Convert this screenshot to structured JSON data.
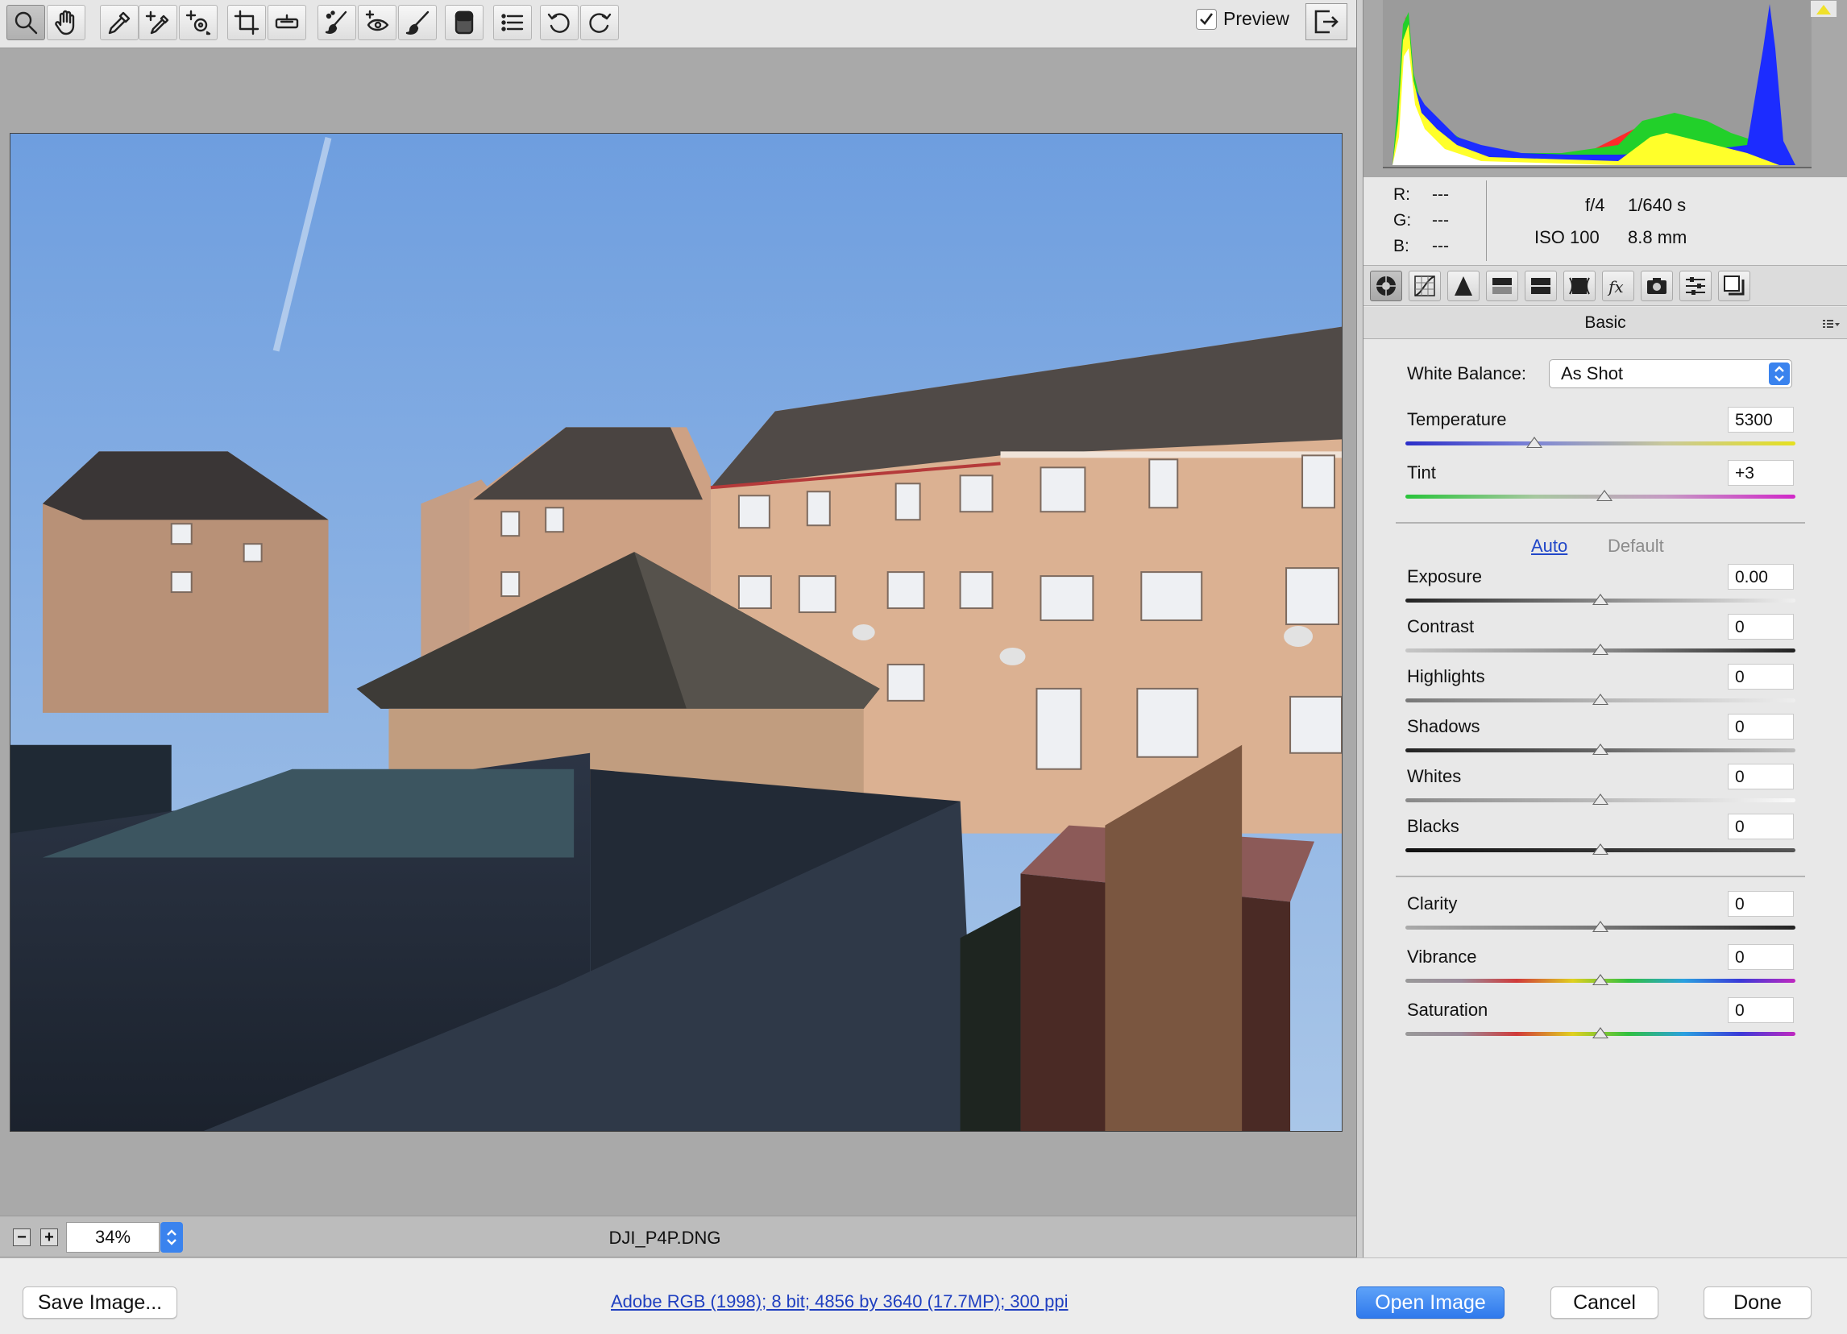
{
  "toolbar": {
    "tools": [
      {
        "name": "zoom-tool",
        "icon": "magnifier-icon",
        "active": true
      },
      {
        "name": "hand-tool",
        "icon": "hand-icon"
      },
      {
        "name": "white-balance-tool",
        "icon": "eyedropper-icon"
      },
      {
        "name": "color-sampler-tool",
        "icon": "eyedropper-plus-icon"
      },
      {
        "name": "targeted-adjustment-tool",
        "icon": "target-icon"
      },
      {
        "name": "crop-tool",
        "icon": "crop-icon"
      },
      {
        "name": "straighten-tool",
        "icon": "level-icon"
      },
      {
        "name": "spot-removal-tool",
        "icon": "brush-spots-icon"
      },
      {
        "name": "red-eye-tool",
        "icon": "eye-icon"
      },
      {
        "name": "adjustment-brush-tool",
        "icon": "brush-icon"
      },
      {
        "name": "graduated-filter-tool",
        "icon": "gradient-icon"
      },
      {
        "name": "preferences-button",
        "icon": "list-icon"
      },
      {
        "name": "rotate-left-button",
        "icon": "rotate-ccw-icon"
      },
      {
        "name": "rotate-right-button",
        "icon": "rotate-cw-icon"
      }
    ],
    "preview_label": "Preview",
    "preview_checked": true
  },
  "zoom": {
    "value": "34%"
  },
  "file": {
    "name": "DJI_P4P.DNG"
  },
  "info": {
    "r_label": "R:",
    "g_label": "G:",
    "b_label": "B:",
    "r_value": "---",
    "g_value": "---",
    "b_value": "---",
    "aperture": "f/4",
    "shutter": "1/640 s",
    "iso": "ISO 100",
    "focal": "8.8 mm"
  },
  "panel": {
    "title": "Basic",
    "tabs": [
      "basic-icon",
      "tone-curve-icon",
      "detail-icon",
      "hsl-icon",
      "split-toning-icon",
      "lens-icon",
      "effects-icon",
      "camera-calibration-icon",
      "presets-icon",
      "snapshots-icon"
    ],
    "white_balance_label": "White Balance:",
    "white_balance_value": "As Shot",
    "auto_label": "Auto",
    "default_label": "Default"
  },
  "sliders": [
    {
      "key": "temperature",
      "label": "Temperature",
      "value": "5300",
      "level": 0.33
    },
    {
      "key": "tint",
      "label": "Tint",
      "value": "+3",
      "level": 0.51
    },
    {
      "key": "exposure",
      "label": "Exposure",
      "value": "0.00",
      "level": 0.5
    },
    {
      "key": "contrast",
      "label": "Contrast",
      "value": "0",
      "level": 0.5
    },
    {
      "key": "highlights",
      "label": "Highlights",
      "value": "0",
      "level": 0.5
    },
    {
      "key": "shadows",
      "label": "Shadows",
      "value": "0",
      "level": 0.5
    },
    {
      "key": "whites",
      "label": "Whites",
      "value": "0",
      "level": 0.5
    },
    {
      "key": "blacks",
      "label": "Blacks",
      "value": "0",
      "level": 0.5
    },
    {
      "key": "clarity",
      "label": "Clarity",
      "value": "0",
      "level": 0.5
    },
    {
      "key": "vibrance",
      "label": "Vibrance",
      "value": "0",
      "level": 0.5
    },
    {
      "key": "saturation",
      "label": "Saturation",
      "value": "0",
      "level": 0.5
    }
  ],
  "bottom": {
    "save_label": "Save Image...",
    "workflow_text": "Adobe RGB (1998); 8 bit; 4856 by 3640 (17.7MP); 300 ppi",
    "open_label": "Open Image",
    "cancel_label": "Cancel",
    "done_label": "Done"
  },
  "colors": {
    "accent": "#3a83ee",
    "link": "#1f3fc0",
    "sky": "#7fa9de",
    "brick": "#c79a7e"
  }
}
